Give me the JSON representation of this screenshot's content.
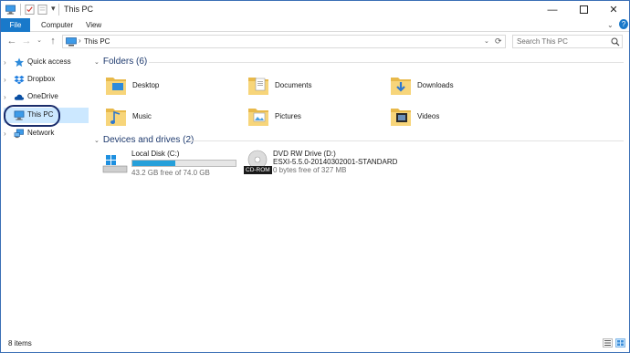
{
  "window": {
    "title": "This PC"
  },
  "ribbon": {
    "tabs": [
      "File",
      "Computer",
      "View"
    ]
  },
  "address": {
    "path": "This PC",
    "search_placeholder": "Search This PC"
  },
  "nav": {
    "items": [
      {
        "label": "Quick access",
        "icon": "star-icon"
      },
      {
        "label": "Dropbox",
        "icon": "dropbox-icon"
      },
      {
        "label": "OneDrive",
        "icon": "cloud-icon"
      },
      {
        "label": "This PC",
        "icon": "computer-icon",
        "selected": true
      },
      {
        "label": "Network",
        "icon": "network-icon"
      }
    ]
  },
  "folders": {
    "header": "Folders (6)",
    "items": [
      {
        "label": "Desktop",
        "icon": "desktop-folder-icon"
      },
      {
        "label": "Documents",
        "icon": "documents-folder-icon"
      },
      {
        "label": "Downloads",
        "icon": "downloads-folder-icon"
      },
      {
        "label": "Music",
        "icon": "music-folder-icon"
      },
      {
        "label": "Pictures",
        "icon": "pictures-folder-icon"
      },
      {
        "label": "Videos",
        "icon": "videos-folder-icon"
      }
    ]
  },
  "drives": {
    "header": "Devices and drives (2)",
    "items": [
      {
        "name": "Local Disk (C:)",
        "free": "43.2 GB free of 74.0 GB",
        "used_fraction": 0.42
      },
      {
        "name": "DVD RW Drive (D:)",
        "volume": "ESXI-5.5.0-20140302001-STANDARD",
        "free": "0 bytes free of 327 MB",
        "badge": "CD-ROM"
      }
    ]
  },
  "status": {
    "count": "8 items"
  },
  "colors": {
    "accent": "#1979ca",
    "selection": "#cce8ff",
    "bar_fill": "#26a0da",
    "heading": "#1e3a6e"
  }
}
